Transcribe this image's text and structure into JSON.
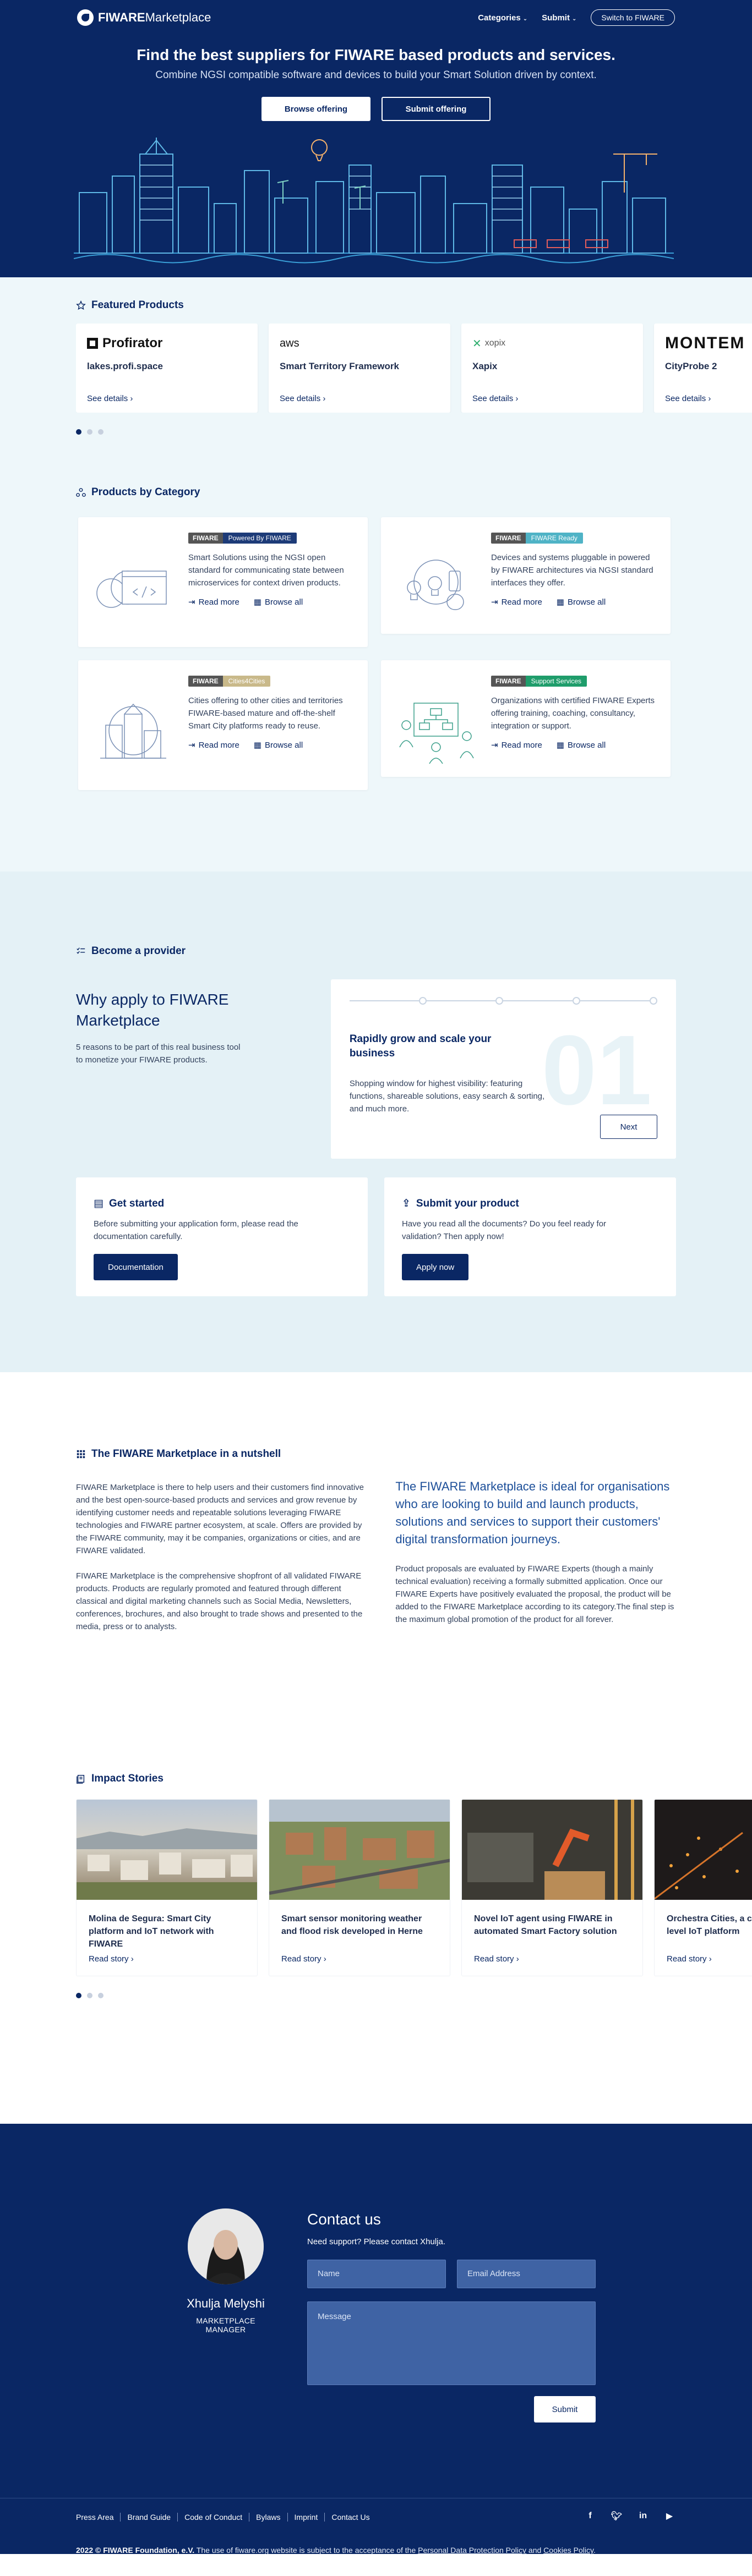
{
  "header": {
    "logo_text_bold": "FIWARE",
    "logo_text": "Marketplace",
    "nav": [
      {
        "label": "Categories"
      },
      {
        "label": "Submit"
      }
    ],
    "switch_label": "Switch to FIWARE"
  },
  "hero": {
    "title": "Find the best suppliers for FIWARE based products and services.",
    "subtitle": "Combine NGSI compatible software and devices to build your Smart Solution driven by context.",
    "browse_label": "Browse offering",
    "submit_label": "Submit offering"
  },
  "featured": {
    "title": "Featured Products",
    "items": [
      {
        "logo": "Profirator",
        "name": "lakes.profi.space",
        "link": "See details"
      },
      {
        "logo": "aws",
        "name": "Smart Territory Framework",
        "link": "See details"
      },
      {
        "logo": "xopix",
        "name": "Xapix",
        "link": "See details"
      },
      {
        "logo": "MONTEM",
        "name": "CityProbe 2",
        "link": "See details"
      }
    ]
  },
  "categories": {
    "title": "Products by Category",
    "cards": [
      {
        "badge_left": "FIWARE",
        "badge_right": "Powered By FIWARE",
        "badge_color": "#1d3b78",
        "desc": "Smart Solutions using the NGSI open standard for communicating state between microservices for context driven products.",
        "read": "Read more",
        "browse": "Browse all"
      },
      {
        "badge_left": "FIWARE",
        "badge_right": "FIWARE Ready",
        "badge_color": "#4fb3c6",
        "desc": "Devices and systems pluggable in powered by FIWARE architectures via NGSI standard interfaces they offer.",
        "read": "Read more",
        "browse": "Browse all"
      },
      {
        "badge_left": "FIWARE",
        "badge_right": "Cities4Cities",
        "badge_color": "#c9b98a",
        "desc": "Cities offering to other cities and territories FIWARE-based mature and off-the-shelf Smart City platforms ready to reuse.",
        "read": "Read more",
        "browse": "Browse all"
      },
      {
        "badge_left": "FIWARE",
        "badge_right": "Support Services",
        "badge_color": "#1f9d6b",
        "desc": "Organizations with certified FIWARE Experts offering training, coaching, consultancy, integration or support.",
        "read": "Read more",
        "browse": "Browse all"
      }
    ]
  },
  "provider": {
    "title": "Become a provider",
    "why_title": "Why apply to FIWARE Marketplace",
    "why_text": "5 reasons to be part of this real business tool to monetize your FIWARE products.",
    "step_title": "Rapidly grow and scale your business",
    "step_text": "Shopping window for highest visibility: featuring functions, shareable solutions, easy search & sorting, and much more.",
    "step_number": "01",
    "next_label": "Next",
    "get_started": {
      "title": "Get started",
      "text": "Before submitting your application form, please read the documentation carefully.",
      "button": "Documentation"
    },
    "submit_product": {
      "title": "Submit your product",
      "text": "Have you read all the documents? Do you feel ready for validation? Then apply now!",
      "button": "Apply now"
    }
  },
  "nutshell": {
    "title": "The FIWARE Marketplace in a nutshell",
    "left_p1": "FIWARE Marketplace is there to help users and their customers find innovative and the best open-source-based products and services and grow revenue by identifying customer needs and repeatable solutions leveraging FIWARE technologies and FIWARE partner ecosystem, at scale. Offers are provided by the FIWARE community, may it be companies, organizations or cities, and are FIWARE validated.",
    "left_p2": "FIWARE Marketplace is the comprehensive shopfront of all validated FIWARE products. Products are regularly promoted and featured through different classical and digital marketing channels such as Social Media, Newsletters, conferences, brochures, and also brought to trade shows and presented to the media, press or to analysts.",
    "right_heading": "The FIWARE Marketplace is ideal for organisations who are looking to build and launch products, solutions and services to support their customers' digital transformation journeys.",
    "right_text": "Product proposals are evaluated by FIWARE Experts (though a mainly technical evaluation) receiving a formally submitted application. Once our FIWARE Experts have positively evaluated the proposal, the product will be added to the FIWARE Marketplace according to its category.The final step is the maximum global promotion of the product for all forever."
  },
  "impact": {
    "title": "Impact Stories",
    "items": [
      {
        "title": "Molina de Segura: Smart City platform and IoT network with FIWARE",
        "link": "Read story"
      },
      {
        "title": "Smart sensor monitoring weather and flood risk developed in Herne",
        "link": "Read story"
      },
      {
        "title": "Novel IoT agent using FIWARE in automated Smart Factory solution",
        "link": "Read story"
      },
      {
        "title": "Orchestra Cities, a co-creation multi level IoT platform",
        "link": "Read story"
      }
    ]
  },
  "contact": {
    "title": "Contact us",
    "support": "Need support? Please contact Xhulja.",
    "person_name": "Xhulja Melyshi",
    "person_role": "MARKETPLACE MANAGER",
    "name_ph": "Name",
    "email_ph": "Email Address",
    "message_ph": "Message",
    "submit": "Submit"
  },
  "footer": {
    "links": [
      "Press Area",
      "Brand Guide",
      "Code of Conduct",
      "Bylaws",
      "Imprint",
      "Contact Us"
    ],
    "social": [
      "facebook-icon",
      "twitter-icon",
      "linkedin-icon",
      "youtube-icon"
    ],
    "copyright": "2022 © FIWARE Foundation, e.V.",
    "legal_pre": " The use of fiware.org website is subject to the acceptance of the ",
    "privacy": "Personal Data Protection Policy",
    "and": " and ",
    "cookies": "Cookies Policy",
    "end": "."
  }
}
